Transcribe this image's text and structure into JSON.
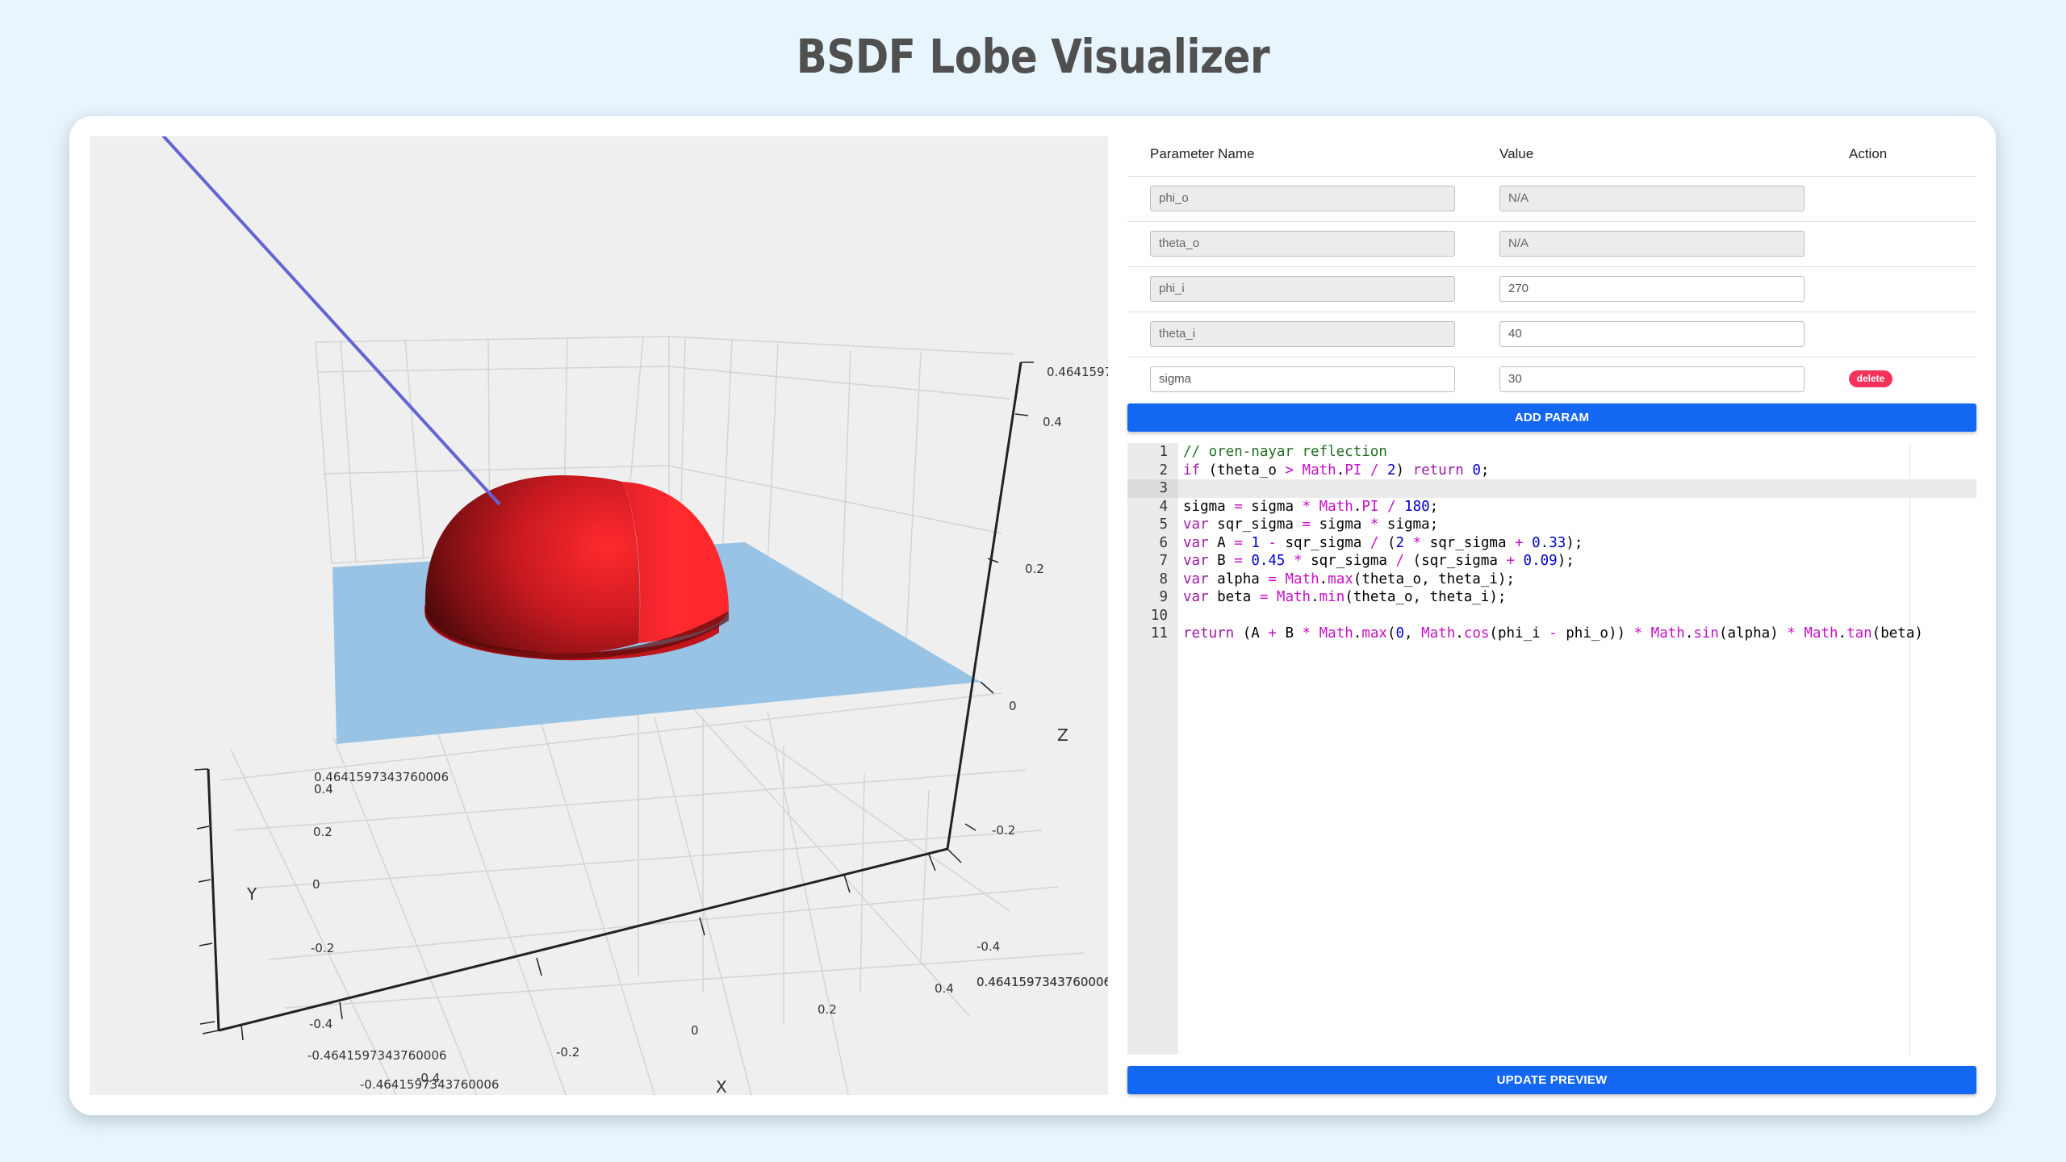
{
  "page": {
    "title": "BSDF Lobe Visualizer"
  },
  "colors": {
    "background": "#e8f5fd",
    "primary_button": "#1467f2",
    "delete_button": "#f4325a",
    "lobe": "#ff2a2d",
    "plane": "#98c3e4",
    "incident_ray": "#6464d2"
  },
  "plot": {
    "axes": {
      "x": {
        "title": "X",
        "ticks": [
          "-0.4",
          "-0.2",
          "0",
          "0.2",
          "0.4"
        ],
        "range_labels": [
          "-0.4641597343760006",
          "0.4641597343760006"
        ]
      },
      "y": {
        "title": "Y",
        "ticks": [
          "-0.4",
          "-0.2",
          "0",
          "0.2",
          "0.4"
        ],
        "range_labels": [
          "-0.4641597343760006",
          "0.4641597343760006"
        ]
      },
      "z": {
        "title": "Z",
        "ticks": [
          "-0.4",
          "-0.2",
          "0",
          "0.2",
          "0.4"
        ],
        "range_labels": [
          "0.4641597"
        ]
      }
    },
    "overlapping_label": "0.4641597343760006"
  },
  "params": {
    "headers": {
      "name": "Parameter Name",
      "value": "Value",
      "action": "Action"
    },
    "rows": [
      {
        "name": "phi_o",
        "value": "N/A",
        "name_disabled": true,
        "value_disabled": true,
        "deletable": false
      },
      {
        "name": "theta_o",
        "value": "N/A",
        "name_disabled": true,
        "value_disabled": true,
        "deletable": false
      },
      {
        "name": "phi_i",
        "value": "270",
        "name_disabled": true,
        "value_disabled": false,
        "deletable": false
      },
      {
        "name": "theta_i",
        "value": "40",
        "name_disabled": true,
        "value_disabled": false,
        "deletable": false
      },
      {
        "name": "sigma",
        "value": "30",
        "name_disabled": false,
        "value_disabled": false,
        "deletable": true
      }
    ],
    "delete_label": "delete",
    "add_label": "ADD PARAM"
  },
  "editor": {
    "active_line": 3,
    "lines": [
      [
        [
          "comment",
          "// oren-nayar reflection"
        ]
      ],
      [
        [
          "keyword",
          "if"
        ],
        [
          "plain",
          " (theta_o "
        ],
        [
          "op",
          ">"
        ],
        [
          "plain",
          " "
        ],
        [
          "builtin",
          "Math"
        ],
        [
          "plain",
          "."
        ],
        [
          "builtin",
          "PI"
        ],
        [
          "plain",
          " "
        ],
        [
          "op",
          "/"
        ],
        [
          "plain",
          " "
        ],
        [
          "number",
          "2"
        ],
        [
          "plain",
          ") "
        ],
        [
          "keyword",
          "return"
        ],
        [
          "plain",
          " "
        ],
        [
          "number",
          "0"
        ],
        [
          "plain",
          ";"
        ]
      ],
      [],
      [
        [
          "plain",
          "sigma "
        ],
        [
          "op",
          "="
        ],
        [
          "plain",
          " sigma "
        ],
        [
          "op",
          "*"
        ],
        [
          "plain",
          " "
        ],
        [
          "builtin",
          "Math"
        ],
        [
          "plain",
          "."
        ],
        [
          "builtin",
          "PI"
        ],
        [
          "plain",
          " "
        ],
        [
          "op",
          "/"
        ],
        [
          "plain",
          " "
        ],
        [
          "number",
          "180"
        ],
        [
          "plain",
          ";"
        ]
      ],
      [
        [
          "keyword",
          "var"
        ],
        [
          "plain",
          " sqr_sigma "
        ],
        [
          "op",
          "="
        ],
        [
          "plain",
          " sigma "
        ],
        [
          "op",
          "*"
        ],
        [
          "plain",
          " sigma;"
        ]
      ],
      [
        [
          "keyword",
          "var"
        ],
        [
          "plain",
          " A "
        ],
        [
          "op",
          "="
        ],
        [
          "plain",
          " "
        ],
        [
          "number",
          "1"
        ],
        [
          "plain",
          " "
        ],
        [
          "op",
          "-"
        ],
        [
          "plain",
          " sqr_sigma "
        ],
        [
          "op",
          "/"
        ],
        [
          "plain",
          " ("
        ],
        [
          "number",
          "2"
        ],
        [
          "plain",
          " "
        ],
        [
          "op",
          "*"
        ],
        [
          "plain",
          " sqr_sigma "
        ],
        [
          "op",
          "+"
        ],
        [
          "plain",
          " "
        ],
        [
          "number",
          "0.33"
        ],
        [
          "plain",
          ");"
        ]
      ],
      [
        [
          "keyword",
          "var"
        ],
        [
          "plain",
          " B "
        ],
        [
          "op",
          "="
        ],
        [
          "plain",
          " "
        ],
        [
          "number",
          "0.45"
        ],
        [
          "plain",
          " "
        ],
        [
          "op",
          "*"
        ],
        [
          "plain",
          " sqr_sigma "
        ],
        [
          "op",
          "/"
        ],
        [
          "plain",
          " (sqr_sigma "
        ],
        [
          "op",
          "+"
        ],
        [
          "plain",
          " "
        ],
        [
          "number",
          "0.09"
        ],
        [
          "plain",
          ");"
        ]
      ],
      [
        [
          "keyword",
          "var"
        ],
        [
          "plain",
          " alpha "
        ],
        [
          "op",
          "="
        ],
        [
          "plain",
          " "
        ],
        [
          "builtin",
          "Math"
        ],
        [
          "plain",
          "."
        ],
        [
          "builtin",
          "max"
        ],
        [
          "plain",
          "(theta_o, theta_i);"
        ]
      ],
      [
        [
          "keyword",
          "var"
        ],
        [
          "plain",
          " beta "
        ],
        [
          "op",
          "="
        ],
        [
          "plain",
          " "
        ],
        [
          "builtin",
          "Math"
        ],
        [
          "plain",
          "."
        ],
        [
          "builtin",
          "min"
        ],
        [
          "plain",
          "(theta_o, theta_i);"
        ]
      ],
      [],
      [
        [
          "keyword",
          "return"
        ],
        [
          "plain",
          " (A "
        ],
        [
          "op",
          "+"
        ],
        [
          "plain",
          " B "
        ],
        [
          "op",
          "*"
        ],
        [
          "plain",
          " "
        ],
        [
          "builtin",
          "Math"
        ],
        [
          "plain",
          "."
        ],
        [
          "builtin",
          "max"
        ],
        [
          "plain",
          "("
        ],
        [
          "number",
          "0"
        ],
        [
          "plain",
          ", "
        ],
        [
          "builtin",
          "Math"
        ],
        [
          "plain",
          "."
        ],
        [
          "builtin",
          "cos"
        ],
        [
          "plain",
          "(phi_i "
        ],
        [
          "op",
          "-"
        ],
        [
          "plain",
          " phi_o)) "
        ],
        [
          "op",
          "*"
        ],
        [
          "plain",
          " "
        ],
        [
          "builtin",
          "Math"
        ],
        [
          "plain",
          "."
        ],
        [
          "builtin",
          "sin"
        ],
        [
          "plain",
          "(alpha) "
        ],
        [
          "op",
          "*"
        ],
        [
          "plain",
          " "
        ],
        [
          "builtin",
          "Math"
        ],
        [
          "plain",
          "."
        ],
        [
          "builtin",
          "tan"
        ],
        [
          "plain",
          "(beta)"
        ]
      ]
    ],
    "update_label": "UPDATE PREVIEW"
  }
}
